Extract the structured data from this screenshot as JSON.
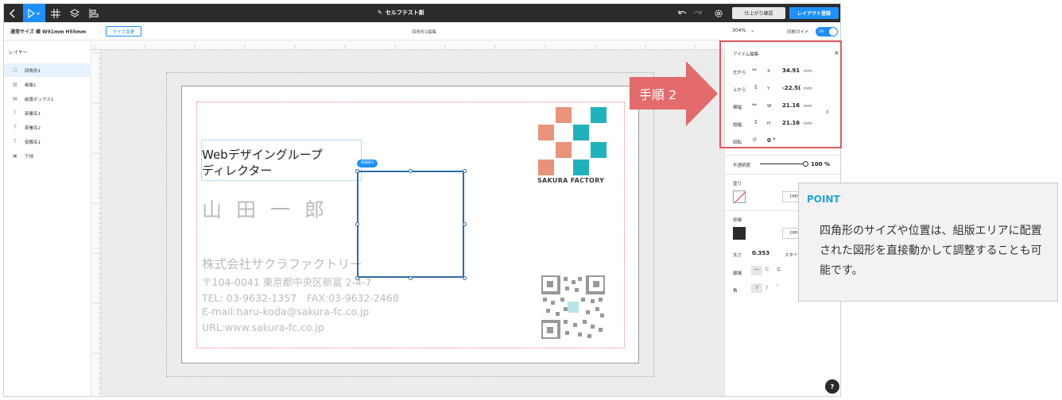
{
  "topbar": {
    "title": "セルフテスト新",
    "confirm_label": "仕上がり確認",
    "save_label": "レイアウト登録"
  },
  "subbar": {
    "size_label": "通常サイズ 横 W91mm H55mm",
    "size_button": "サイズ変更",
    "breadcrumb": "四角形1編集",
    "zoom": "304%",
    "print_guide_label": "印刷ガイド",
    "toggle_label": "ON"
  },
  "layers": {
    "title": "レイヤー",
    "items": [
      {
        "label": "四角形1",
        "icon": "square-icon",
        "active": true
      },
      {
        "label": "画像1",
        "icon": "image-icon"
      },
      {
        "label": "組版ボックス1",
        "icon": "textbox-icon"
      },
      {
        "label": "部署名1",
        "icon": "text-icon"
      },
      {
        "label": "部署名2",
        "icon": "text-icon"
      },
      {
        "label": "役職名1",
        "icon": "text-icon"
      },
      {
        "label": "下地",
        "icon": "background-icon"
      }
    ]
  },
  "card": {
    "group_line1": "Webデザイングループ",
    "group_line2": "ディレクター",
    "name": "山田一郎",
    "company": "株式会社サクラファクトリー",
    "address": "〒104-0041 東京都中央区新富 2-4-7",
    "tel": "TEL: 03-9632-1357　FAX:03-9632-2468",
    "email": "E-mail:haru-koda@sakura-fc.co.jp",
    "url": "URL:www.sakura-fc.co.jp",
    "logo_text": "SAKURA FACTORY",
    "selected_tag": "四角形1"
  },
  "panel": {
    "title": "アイテム編集",
    "left_label": "左から",
    "top_label": "上から",
    "width_label": "横幅",
    "height_label": "縦幅",
    "rotate_label": "回転",
    "x_axis": "X",
    "y_axis": "Y",
    "w_axis": "W",
    "h_axis": "H",
    "x_value": "34.91",
    "y_value": "-22.5(",
    "w_value": "21.16",
    "h_value": "21.16",
    "unit": "mm",
    "rotate_value": "0 °",
    "opacity_label": "不透明度",
    "opacity_value": "100 %",
    "fill_label": "塗り",
    "cmyk_label": "CMY",
    "stroke_label": "枠線",
    "thickness_label": "太さ",
    "thickness_value": "0.353",
    "style_label": "スタイル",
    "end_label": "線端",
    "corner_label": "角",
    "help": "?"
  },
  "annotation": {
    "step": "手順 2",
    "point_title": "POINT",
    "point_body": "四角形のサイズや位置は、組版エリアに配置された図形を直接動かして調整することも可能です。"
  },
  "colors": {
    "accent": "#1e90ff",
    "annotation_red": "#e36b6b",
    "point_blue": "#1ea5d8",
    "logo_salmon": "#e8937a",
    "logo_teal": "#1fb2bd"
  }
}
